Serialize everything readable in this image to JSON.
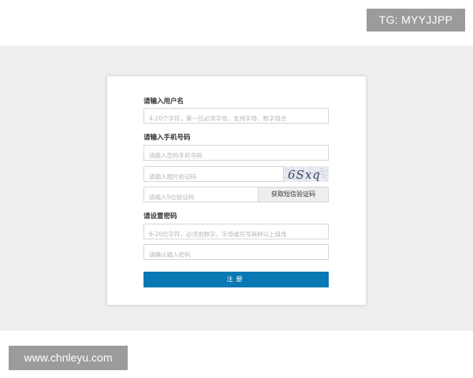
{
  "watermarks": {
    "top_right": "TG: MYYJJPP",
    "bottom_left": "www.chnleyu.com"
  },
  "form": {
    "username": {
      "label": "请输入用户名",
      "placeholder": "4-20个字符，第一位必须字母，支持字母、数字组合"
    },
    "phone": {
      "label": "请输入手机号码",
      "phone_placeholder": "请输入您的手机号码",
      "image_code_placeholder": "请输入图片验证码",
      "captcha_text": "6Sxq",
      "sms_code_placeholder": "请输入5位验证码",
      "sms_button_label": "获取短信验证码"
    },
    "password": {
      "label": "请设置密码",
      "password_placeholder": "6-20位字符，必须由数字、字母或符号两种以上组成",
      "confirm_placeholder": "请确认输入密码"
    },
    "submit_label": "注册"
  },
  "colors": {
    "accent": "#0a78b3",
    "background": "#efefef",
    "badge": "#9b9b9b"
  }
}
